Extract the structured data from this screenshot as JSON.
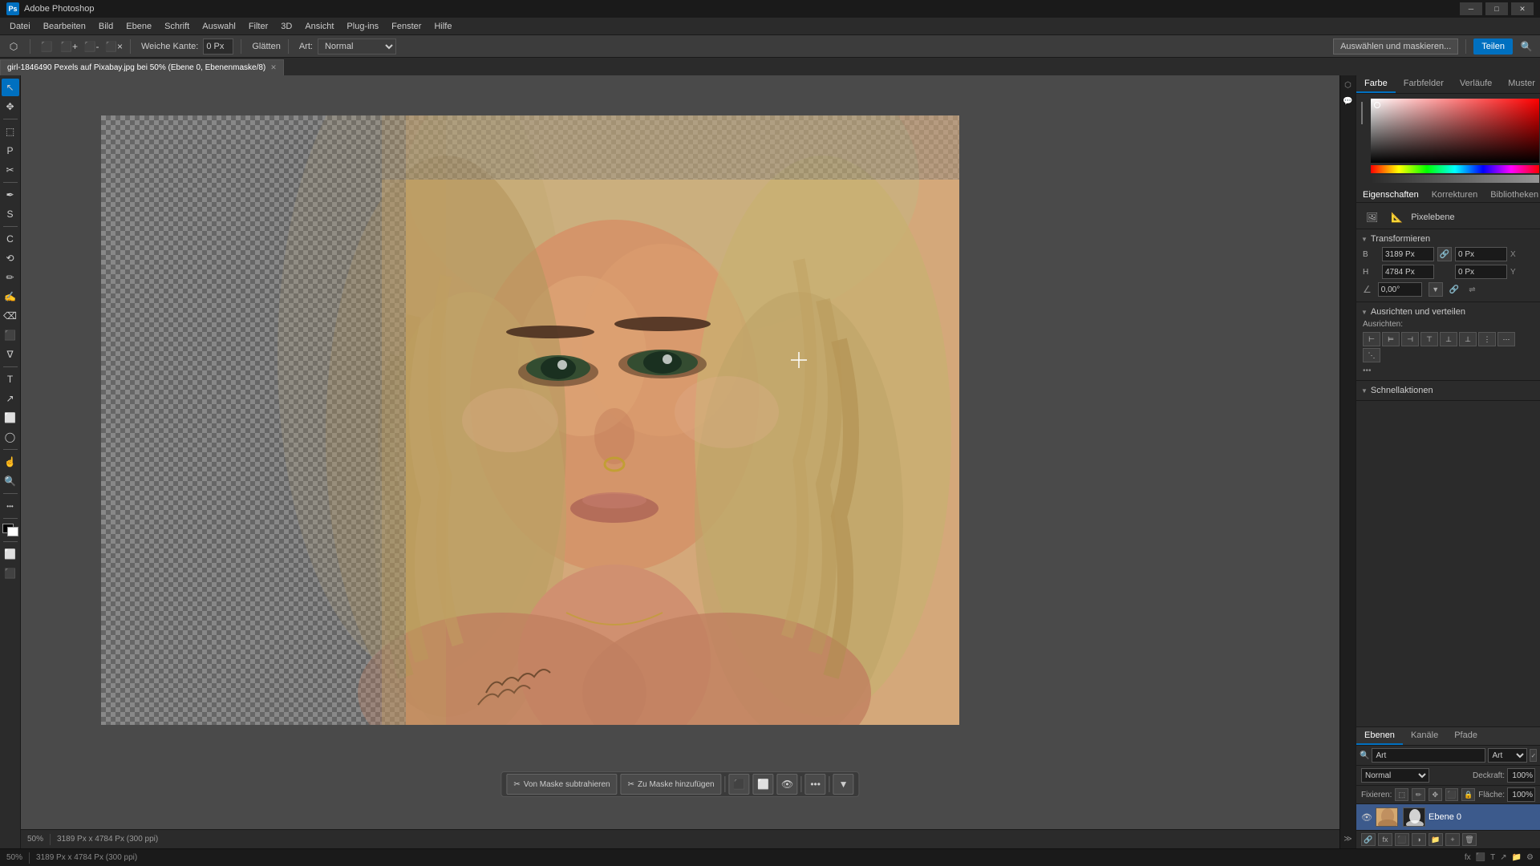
{
  "titleBar": {
    "appName": "Ps",
    "title": "Adobe Photoshop",
    "winMinLabel": "─",
    "winMaxLabel": "□",
    "winCloseLabel": "✕"
  },
  "menuBar": {
    "items": [
      "Datei",
      "Bearbeiten",
      "Bild",
      "Ebene",
      "Schrift",
      "Auswahl",
      "Filter",
      "3D",
      "Ansicht",
      "Plug-ins",
      "Fenster",
      "Hilfe"
    ]
  },
  "optionsBar": {
    "softEdgeLabel": "Weiche Kante:",
    "softEdgeValue": "0 Px",
    "glittenLabel": "Glätten",
    "artLabel": "Art:",
    "artValue": "Normal",
    "selectMaskLabel": "Auswählen und maskieren...",
    "shareLabel": "Teilen"
  },
  "tab": {
    "title": "girl-1846490 Pexels auf Pixabay.jpg bei 50% (Ebene 0, Ebenenmaske/8)",
    "closeIcon": "✕"
  },
  "tools": {
    "items": [
      "↖",
      "✥",
      "⬚",
      "◯",
      "P",
      "✂",
      "✒",
      "S",
      "C",
      "⟲",
      "✏",
      "✍",
      "⌫",
      "⬛",
      "∇",
      "T",
      "↗",
      "⬜",
      "☝",
      "🔍",
      "•••"
    ]
  },
  "canvasStatus": {
    "zoom": "50%",
    "dimensions": "3189 Px x 4784 Px (300 ppi)"
  },
  "floatingToolbar": {
    "subtractBtn": "Von Maske subtrahieren",
    "addBtn": "Zu Maske hinzufügen",
    "moreIcon": "•••"
  },
  "rightPanel": {
    "colorTabs": [
      "Farbe",
      "Farbfelder",
      "Verläufe",
      "Muster"
    ],
    "activeColorTab": "Farbe"
  },
  "propertiesSection": {
    "tabs": [
      "Eigenschaften",
      "Korrekturen",
      "Bibliotheken"
    ],
    "activeTab": "Eigenschaften",
    "icons": [
      "🖼",
      "📐",
      "Pixelebene"
    ],
    "transformSection": {
      "label": "Transformieren",
      "xLabel": "B",
      "xValue": "3189 Px",
      "xOffset": "0 Px",
      "hLabel": "H",
      "hValue": "4784 Px",
      "hOffset": "0 Px",
      "angleValue": "0,00°",
      "linkIcon": "🔗"
    },
    "alignSection": {
      "label": "Ausrichten und verteilen",
      "subLabel": "Ausrichten:",
      "moreIcon": "•••",
      "alignBtns": [
        "⊢",
        "⊨",
        "⊣",
        "⊤",
        "⊥⊥",
        "⊥"
      ]
    },
    "quickActionsSection": {
      "label": "Schnellaktionen"
    }
  },
  "layersPanel": {
    "tabs": [
      "Ebenen",
      "Kanäle",
      "Pfade"
    ],
    "activeTab": "Ebenen",
    "searchPlaceholder": "Art",
    "blendMode": "Normal",
    "opacityLabel": "Deckraft:",
    "opacityValue": "100%",
    "lockLabel": "Fixieren:",
    "fillLabel": "Fläche:",
    "fillValue": "100%",
    "layer": {
      "name": "Ebene 0",
      "visible": true
    }
  },
  "statusBar": {
    "zoom": "50%",
    "dimensions": "3189 Px x 4784 Px (300 ppi)",
    "rightIcons": [
      "fx",
      "⬛",
      "T",
      "↗",
      "📁",
      "⚙"
    ]
  },
  "colors": {
    "accent": "#0070c0",
    "activeLayer": "#3c5a8c",
    "bg": "#2b2b2b",
    "darkBg": "#1a1a1a",
    "border": "#555555"
  }
}
